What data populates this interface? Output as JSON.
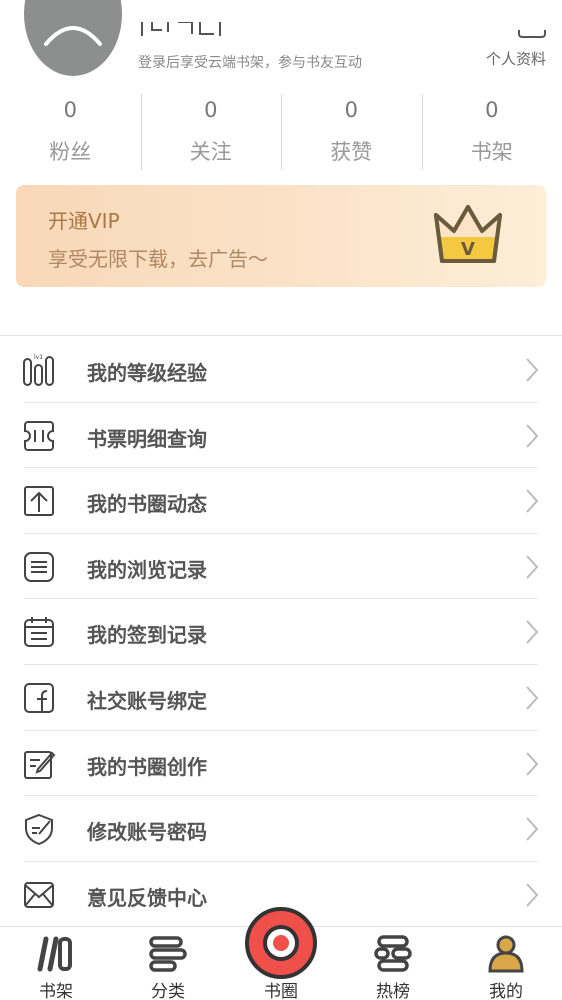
{
  "header": {
    "login_tip": "登录后享受云端书架，参与书友互动",
    "profile_link": "个人资料"
  },
  "stats": [
    {
      "value": "0",
      "label": "粉丝"
    },
    {
      "value": "0",
      "label": "关注"
    },
    {
      "value": "0",
      "label": "获赞"
    },
    {
      "value": "0",
      "label": "书架"
    }
  ],
  "vip": {
    "title": "开通VIP",
    "subtitle": "享受无限下载，去广告～",
    "badge_letter": "V"
  },
  "menu": [
    {
      "label": "我的等级经验",
      "icon": "level-bars-icon"
    },
    {
      "label": "书票明细查询",
      "icon": "ticket-icon"
    },
    {
      "label": "我的书圈动态",
      "icon": "upload-arrow-icon"
    },
    {
      "label": "我的浏览记录",
      "icon": "document-lines-icon"
    },
    {
      "label": "我的签到记录",
      "icon": "calendar-icon"
    },
    {
      "label": "社交账号绑定",
      "icon": "facebook-icon"
    },
    {
      "label": "我的书圈创作",
      "icon": "edit-note-icon"
    },
    {
      "label": "修改账号密码",
      "icon": "shield-edit-icon"
    },
    {
      "label": "意见反馈中心",
      "icon": "envelope-icon"
    }
  ],
  "level_icon_text": "lv1",
  "tabs": [
    {
      "label": "书架",
      "icon": "bookshelf-icon"
    },
    {
      "label": "分类",
      "icon": "category-icon"
    },
    {
      "label": "书圈",
      "icon": "circle-icon"
    },
    {
      "label": "热榜",
      "icon": "ranking-icon"
    },
    {
      "label": "我的",
      "icon": "profile-icon"
    }
  ],
  "colors": {
    "vip_text": "#a77746",
    "accent_red": "#f0504a",
    "crown_yellow": "#f5c842",
    "profile_tab_gold": "#d9a64a"
  }
}
